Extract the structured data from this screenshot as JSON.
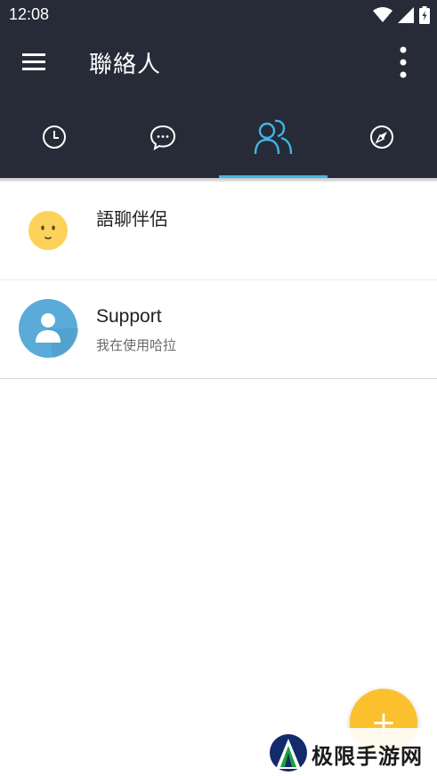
{
  "status_bar": {
    "time": "12:08"
  },
  "app_bar": {
    "title": "聯絡人"
  },
  "tabs": [
    {
      "id": "recent",
      "icon": "clock-icon",
      "active": false
    },
    {
      "id": "chats",
      "icon": "chat-bubble-icon",
      "active": false
    },
    {
      "id": "contacts",
      "icon": "people-icon",
      "active": true
    },
    {
      "id": "discover",
      "icon": "compass-icon",
      "active": false
    }
  ],
  "contacts": [
    {
      "name": "語聊伴侶",
      "status": "",
      "avatar": "neutral-face-icon"
    },
    {
      "name": "Support",
      "status": "我在使用哈拉",
      "avatar": "person-icon"
    }
  ],
  "fab": {
    "label": "+"
  },
  "watermark": {
    "text": "极限手游网"
  },
  "colors": {
    "header_bg": "#262b37",
    "accent": "#41b6e6",
    "fab": "#fbc02d",
    "avatar_blue": "#5aabd8",
    "emoji_yellow": "#fdd25a"
  }
}
